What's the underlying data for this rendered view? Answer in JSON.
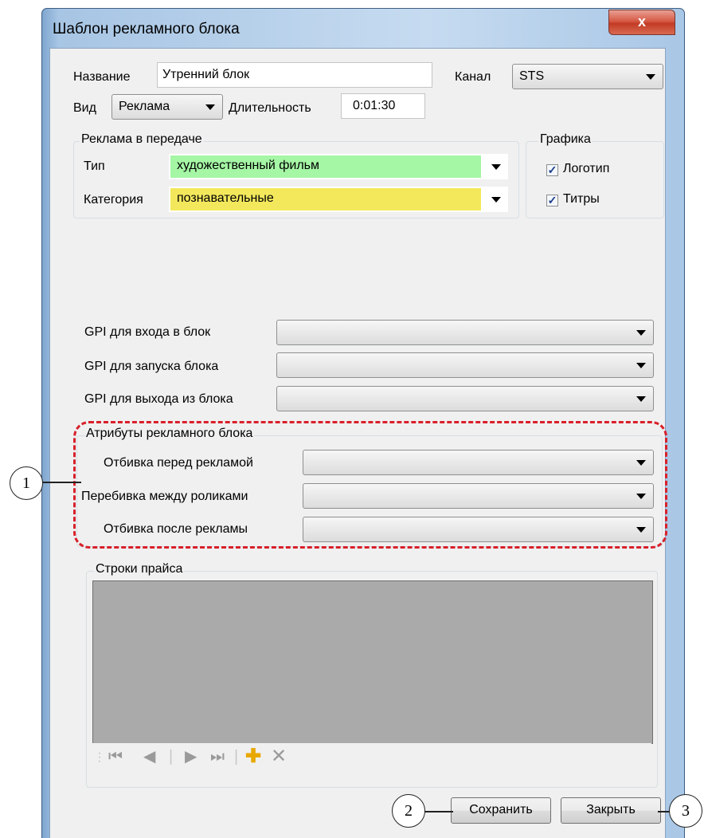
{
  "window": {
    "title": "Шаблон рекламного блока",
    "close_label": "x"
  },
  "top": {
    "name_label": "Название",
    "name_value": "Утренний блок",
    "channel_label": "Канал",
    "channel_value": "STS",
    "kind_label": "Вид",
    "kind_value": "Реклама",
    "duration_label": "Длительность",
    "duration_value": "0:01:30"
  },
  "ad_in_program": {
    "legend": "Реклама в передаче",
    "type_label": "Тип",
    "type_value": "художественный фильм",
    "type_color": "#a5f6a5",
    "category_label": "Категория",
    "category_value": "познавательные",
    "category_color": "#f3e85c"
  },
  "graphics": {
    "legend": "Графика",
    "logo_label": "Логотип",
    "logo_checked": true,
    "titles_label": "Титры",
    "titles_checked": true
  },
  "gpi": {
    "enter_label": "GPI для входа в блок",
    "enter_value": "",
    "start_label": "GPI для запуска блока",
    "start_value": "",
    "exit_label": "GPI для выхода из блока",
    "exit_value": ""
  },
  "attributes": {
    "legend": "Атрибуты рекламного блока",
    "before_label": "Отбивка перед рекламой",
    "before_value": "",
    "between_label": "Перебивка между роликами",
    "between_value": "",
    "after_label": "Отбивка после рекламы",
    "after_value": ""
  },
  "price_rows": {
    "legend": "Строки прайса"
  },
  "nav_icons": [
    "first-icon",
    "prev-icon",
    "next-icon",
    "last-icon",
    "add-icon",
    "delete-icon"
  ],
  "buttons": {
    "save": "Сохранить",
    "close": "Закрыть"
  },
  "callouts": {
    "c1": "1",
    "c2": "2",
    "c3": "3"
  },
  "colors": {
    "highlight_dash": "#d8202a",
    "grid_bg": "#aaaaaa"
  }
}
